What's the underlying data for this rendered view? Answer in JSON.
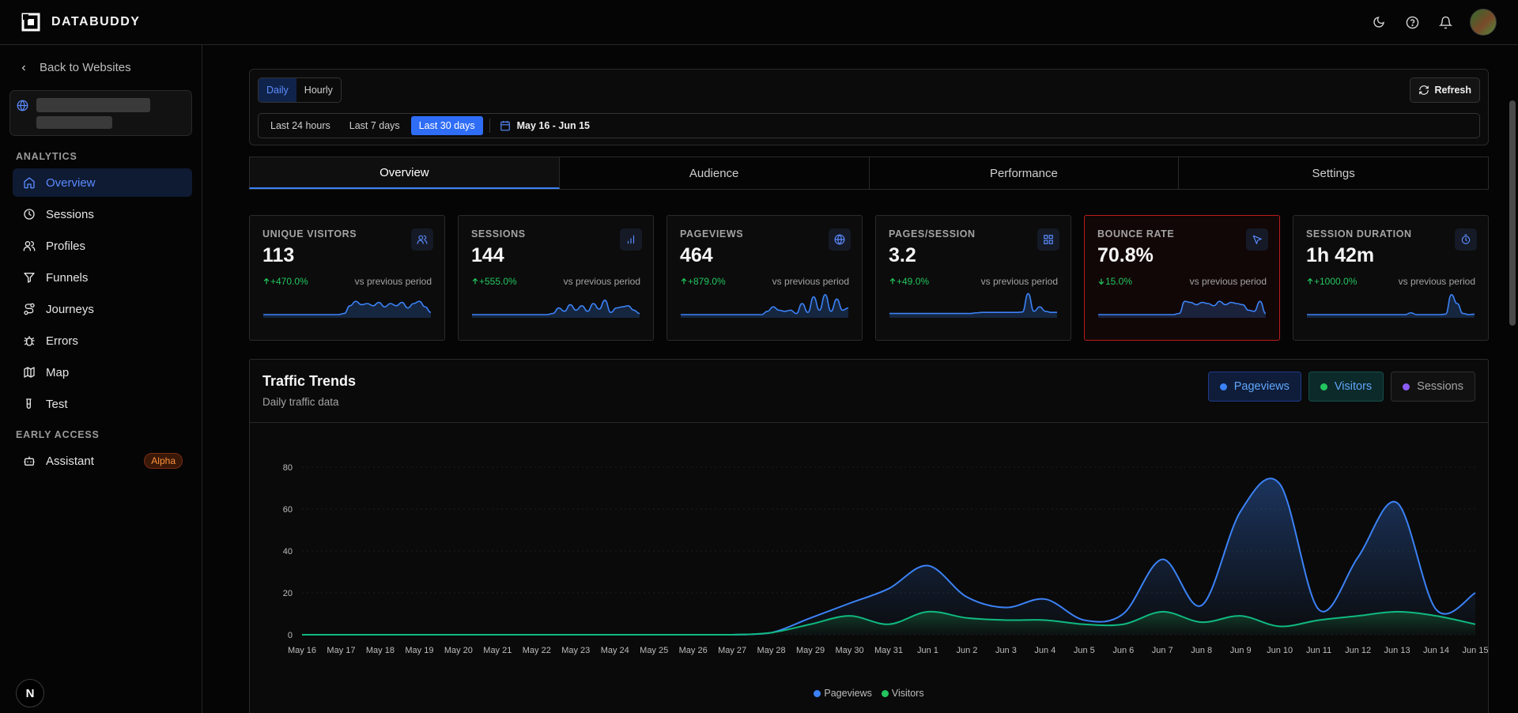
{
  "brand": {
    "name": "DATABUDDY"
  },
  "sidebar": {
    "back_label": "Back to Websites",
    "sections": {
      "analytics": "ANALYTICS",
      "early_access": "EARLY ACCESS"
    },
    "items": [
      {
        "label": "Overview",
        "icon": "home-icon",
        "active": true
      },
      {
        "label": "Sessions",
        "icon": "clock-icon"
      },
      {
        "label": "Profiles",
        "icon": "users-icon"
      },
      {
        "label": "Funnels",
        "icon": "funnel-icon"
      },
      {
        "label": "Journeys",
        "icon": "route-icon"
      },
      {
        "label": "Errors",
        "icon": "bug-icon"
      },
      {
        "label": "Map",
        "icon": "map-icon"
      },
      {
        "label": "Test",
        "icon": "test-tube-icon"
      }
    ],
    "assistant": {
      "label": "Assistant",
      "badge": "Alpha"
    },
    "footer_logo": "N"
  },
  "filters": {
    "granularity": [
      "Daily",
      "Hourly"
    ],
    "granularity_selected": "Daily",
    "refresh_label": "Refresh",
    "ranges": [
      "Last 24 hours",
      "Last 7 days",
      "Last 30 days"
    ],
    "range_selected": "Last 30 days",
    "date_range": "May 16 - Jun 15"
  },
  "tabs": [
    "Overview",
    "Audience",
    "Performance",
    "Settings"
  ],
  "tab_selected": "Overview",
  "metrics": [
    {
      "label": "UNIQUE VISITORS",
      "value": "113",
      "delta": "+470.0%",
      "direction": "up",
      "vs": "vs previous period",
      "icon": "users-icon",
      "spark": [
        0,
        0,
        0,
        0,
        0,
        0,
        0,
        0,
        0,
        0,
        0,
        0,
        0,
        0,
        0.05,
        0.4,
        0.6,
        0.45,
        0.5,
        0.4,
        0.55,
        0.35,
        0.5,
        0.4,
        0.55,
        0.3,
        0.5,
        0.6,
        0.35,
        0.1
      ]
    },
    {
      "label": "SESSIONS",
      "value": "144",
      "delta": "+555.0%",
      "direction": "up",
      "vs": "vs previous period",
      "icon": "bar-chart-icon",
      "spark": [
        0,
        0,
        0,
        0,
        0,
        0,
        0,
        0,
        0,
        0,
        0,
        0,
        0,
        0,
        0.05,
        0.3,
        0.15,
        0.45,
        0.2,
        0.4,
        0.15,
        0.5,
        0.25,
        0.65,
        0.1,
        0.3,
        0.35,
        0.4,
        0.2,
        0.05
      ]
    },
    {
      "label": "PAGEVIEWS",
      "value": "464",
      "delta": "+879.0%",
      "direction": "up",
      "vs": "vs previous period",
      "icon": "globe-icon",
      "spark": [
        0,
        0,
        0,
        0,
        0,
        0,
        0,
        0,
        0,
        0,
        0,
        0,
        0,
        0,
        0,
        0.15,
        0.35,
        0.2,
        0.15,
        0.2,
        0.05,
        0.5,
        0.1,
        0.8,
        0.2,
        0.9,
        0.15,
        0.7,
        0.2,
        0.3
      ]
    },
    {
      "label": "PAGES/SESSION",
      "value": "3.2",
      "delta": "+49.0%",
      "direction": "up",
      "vs": "vs previous period",
      "icon": "grid-icon",
      "spark": [
        0.05,
        0.05,
        0.05,
        0.05,
        0.05,
        0.05,
        0.05,
        0.05,
        0.05,
        0.05,
        0.05,
        0.05,
        0.05,
        0.05,
        0.05,
        0.08,
        0.1,
        0.1,
        0.1,
        0.1,
        0.1,
        0.1,
        0.1,
        0.12,
        0.95,
        0.15,
        0.35,
        0.15,
        0.1,
        0.1
      ]
    },
    {
      "label": "BOUNCE RATE",
      "value": "70.8%",
      "delta": "15.0%",
      "direction": "down",
      "vs": "vs previous period",
      "icon": "cursor-icon",
      "alert": true,
      "spark": [
        0,
        0,
        0,
        0,
        0,
        0,
        0,
        0,
        0,
        0,
        0,
        0,
        0,
        0,
        0.05,
        0.6,
        0.55,
        0.45,
        0.55,
        0.5,
        0.4,
        0.6,
        0.45,
        0.55,
        0.5,
        0.45,
        0.2,
        0.15,
        0.6,
        0.05
      ]
    },
    {
      "label": "SESSION DURATION",
      "value": "1h 42m",
      "delta": "+1000.0%",
      "direction": "up",
      "vs": "vs previous period",
      "icon": "timer-icon",
      "spark": [
        0,
        0,
        0,
        0,
        0,
        0,
        0,
        0,
        0,
        0,
        0,
        0,
        0,
        0,
        0,
        0,
        0,
        0,
        0.08,
        0,
        0,
        0,
        0,
        0,
        0.02,
        0.9,
        0.5,
        0.05,
        0,
        0.02
      ]
    }
  ],
  "traffic": {
    "title": "Traffic Trends",
    "subtitle": "Daily traffic data",
    "toggles": [
      {
        "label": "Pageviews",
        "color": "#3b82f6",
        "active": true
      },
      {
        "label": "Visitors",
        "color": "#22c55e",
        "active": true
      },
      {
        "label": "Sessions",
        "color": "#8b5cf6",
        "active": false
      }
    ],
    "legend": [
      {
        "label": "Pageviews",
        "color": "#3b82f6"
      },
      {
        "label": "Visitors",
        "color": "#22c55e"
      }
    ]
  },
  "chart_data": {
    "type": "area",
    "x": [
      "May 16",
      "May 17",
      "May 18",
      "May 19",
      "May 20",
      "May 21",
      "May 22",
      "May 23",
      "May 24",
      "May 25",
      "May 26",
      "May 27",
      "May 28",
      "May 29",
      "May 30",
      "May 31",
      "Jun 1",
      "Jun 2",
      "Jun 3",
      "Jun 4",
      "Jun 5",
      "Jun 6",
      "Jun 7",
      "Jun 8",
      "Jun 9",
      "Jun 10",
      "Jun 11",
      "Jun 12",
      "Jun 13",
      "Jun 14",
      "Jun 15"
    ],
    "series": [
      {
        "name": "Pageviews",
        "color": "#3b82f6",
        "values": [
          0,
          0,
          0,
          0,
          0,
          0,
          0,
          0,
          0,
          0,
          0,
          0,
          1,
          8,
          15,
          22,
          33,
          18,
          13,
          17,
          7,
          10,
          36,
          14,
          59,
          72,
          12,
          37,
          63,
          12,
          20
        ]
      },
      {
        "name": "Visitors",
        "color": "#22c55e",
        "values": [
          0,
          0,
          0,
          0,
          0,
          0,
          0,
          0,
          0,
          0,
          0,
          0,
          1,
          5,
          9,
          5,
          11,
          8,
          7,
          7,
          5,
          5,
          11,
          6,
          9,
          4,
          7,
          9,
          11,
          9,
          5
        ]
      }
    ],
    "yticks": [
      0,
      20,
      40,
      60,
      80
    ],
    "ylim": [
      0,
      80
    ],
    "grid": true,
    "legend": "bottom-center"
  }
}
